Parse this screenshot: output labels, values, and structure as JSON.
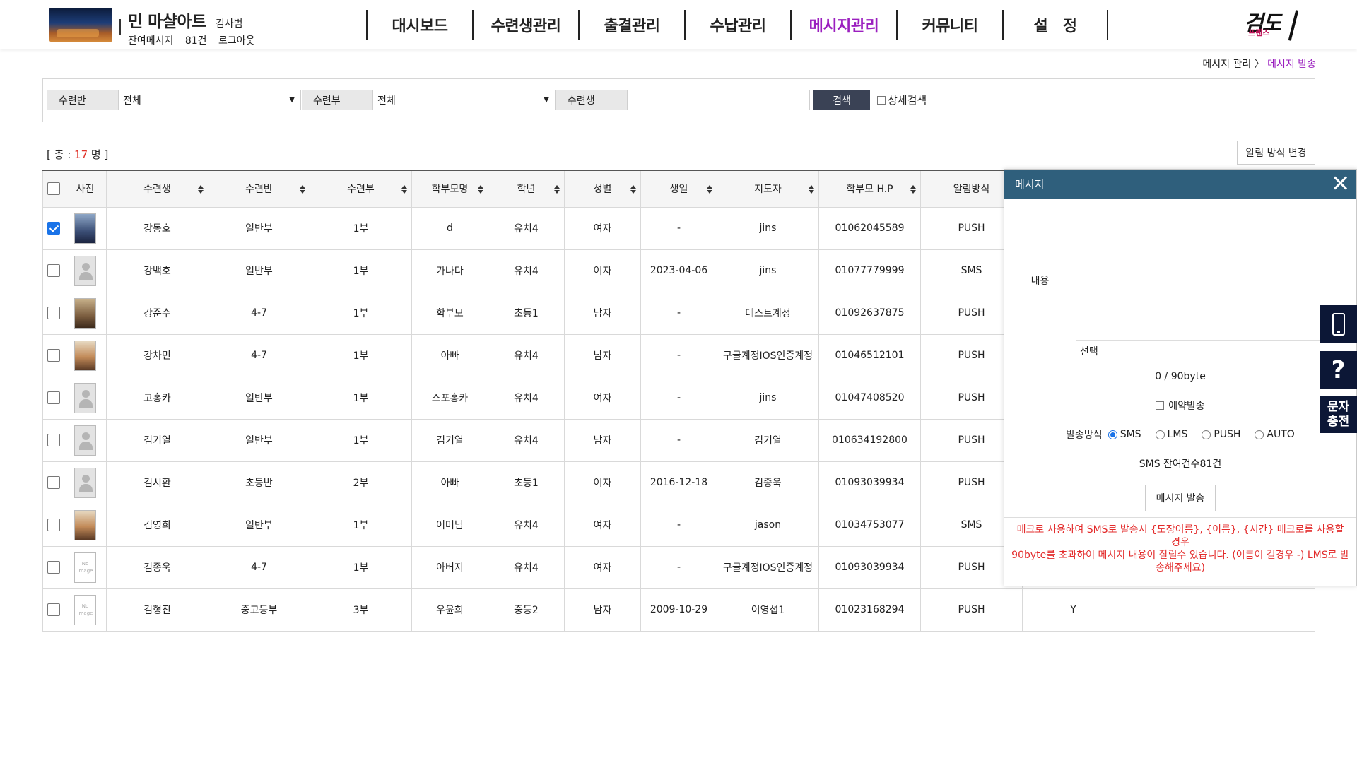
{
  "header": {
    "academy_name": "민 마샬아트",
    "teacher_name": "김사범",
    "remaining_label": "잔여메시지",
    "remaining_count": "81건",
    "logout": "로그아웃",
    "nav": [
      "대시보드",
      "수련생관리",
      "출결관리",
      "수납관리",
      "메시지관리",
      "커뮤니티",
      "설　정"
    ],
    "active_nav": "메시지관리",
    "logo_main": "검도",
    "logo_sub": "프렌즈"
  },
  "breadcrumb": {
    "parent": "메시지 관리",
    "separator": "〉",
    "current": "메시지 발송"
  },
  "search": {
    "class_label": "수련반",
    "class_value": "전체",
    "part_label": "수련부",
    "part_value": "전체",
    "student_label": "수련생",
    "student_value": "",
    "search_button": "검색",
    "detail_search": "상세검색"
  },
  "summary": {
    "total_prefix": "[ 총 :",
    "total_count": "17",
    "total_suffix": "명 ]",
    "notice_button": "알림 방식 변경"
  },
  "table": {
    "columns": [
      "사진",
      "수련생",
      "수련반",
      "수련부",
      "학부모명",
      "학년",
      "성별",
      "생일",
      "지도자",
      "학부모 H.P",
      "알림방식",
      "",
      ""
    ],
    "rows": [
      {
        "checked": true,
        "photo": "real",
        "name": "강동호",
        "class": "일반부",
        "part": "1부",
        "parent": "d",
        "grade": "유치4",
        "gender": "여자",
        "birth": "-",
        "coach": "jins",
        "phone": "01062045589",
        "notify": "PUSH",
        "extra": ""
      },
      {
        "checked": false,
        "photo": "default",
        "name": "강백호",
        "class": "일반부",
        "part": "1부",
        "parent": "가나다",
        "grade": "유치4",
        "gender": "여자",
        "birth": "2023-04-06",
        "coach": "jins",
        "phone": "01077779999",
        "notify": "SMS",
        "extra": ""
      },
      {
        "checked": false,
        "photo": "real2",
        "name": "강준수",
        "class": "4-7",
        "part": "1부",
        "parent": "학부모",
        "grade": "초등1",
        "gender": "남자",
        "birth": "-",
        "coach": "테스트계정",
        "phone": "01092637875",
        "notify": "PUSH",
        "extra": ""
      },
      {
        "checked": false,
        "photo": "real3",
        "name": "강차민",
        "class": "4-7",
        "part": "1부",
        "parent": "아빠",
        "grade": "유치4",
        "gender": "남자",
        "birth": "-",
        "coach": "구글계정IOS인증계정",
        "phone": "01046512101",
        "notify": "PUSH",
        "extra": ""
      },
      {
        "checked": false,
        "photo": "default",
        "name": "고홍카",
        "class": "일반부",
        "part": "1부",
        "parent": "스포홍카",
        "grade": "유치4",
        "gender": "여자",
        "birth": "-",
        "coach": "jins",
        "phone": "01047408520",
        "notify": "PUSH",
        "extra": ""
      },
      {
        "checked": false,
        "photo": "default",
        "name": "김기열",
        "class": "일반부",
        "part": "1부",
        "parent": "김기열",
        "grade": "유치4",
        "gender": "남자",
        "birth": "-",
        "coach": "김기열",
        "phone": "010634192800",
        "notify": "PUSH",
        "extra": ""
      },
      {
        "checked": false,
        "photo": "default",
        "name": "김시환",
        "class": "초등반",
        "part": "2부",
        "parent": "아빠",
        "grade": "초등1",
        "gender": "여자",
        "birth": "2016-12-18",
        "coach": "김종욱",
        "phone": "01093039934",
        "notify": "PUSH",
        "extra": ""
      },
      {
        "checked": false,
        "photo": "real3",
        "name": "김영희",
        "class": "일반부",
        "part": "1부",
        "parent": "어머님",
        "grade": "유치4",
        "gender": "여자",
        "birth": "-",
        "coach": "jason",
        "phone": "01034753077",
        "notify": "SMS",
        "extra": ""
      },
      {
        "checked": false,
        "photo": "none",
        "name": "김종욱",
        "class": "4-7",
        "part": "1부",
        "parent": "아버지",
        "grade": "유치4",
        "gender": "여자",
        "birth": "-",
        "coach": "구글계정IOS인증계정",
        "phone": "01093039934",
        "notify": "PUSH",
        "extra": ""
      },
      {
        "checked": false,
        "photo": "none",
        "name": "김형진",
        "class": "중고등부",
        "part": "3부",
        "parent": "우윤희",
        "grade": "중등2",
        "gender": "남자",
        "birth": "2009-10-29",
        "coach": "이영섭1",
        "phone": "01023168294",
        "notify": "PUSH",
        "extra": "Y"
      }
    ],
    "no_image_text": "No Image"
  },
  "message_panel": {
    "title": "메시지",
    "content_label": "내용",
    "content_value": "",
    "select_label": "선택",
    "byte_counter": "0 / 90byte",
    "reserve_label": "예약발송",
    "method_label": "발송방식",
    "methods": [
      "SMS",
      "LMS",
      "PUSH",
      "AUTO"
    ],
    "selected_method": "SMS",
    "remaining_info": "SMS 잔여건수81건",
    "send_button": "메시지 발송",
    "note_line1": "메크로 사용하여 SMS로 발송시 {도장이름}, {이름}, {시간} 메크로를 사용할 경우",
    "note_line2": "90byte를 초과하여 메시지 내용이 잘릴수 있습니다. (이름이 길경우 -) LMS로 발송해주세요)"
  },
  "side_buttons": {
    "help": "?",
    "charge_line1": "문자",
    "charge_line2": "충전"
  }
}
